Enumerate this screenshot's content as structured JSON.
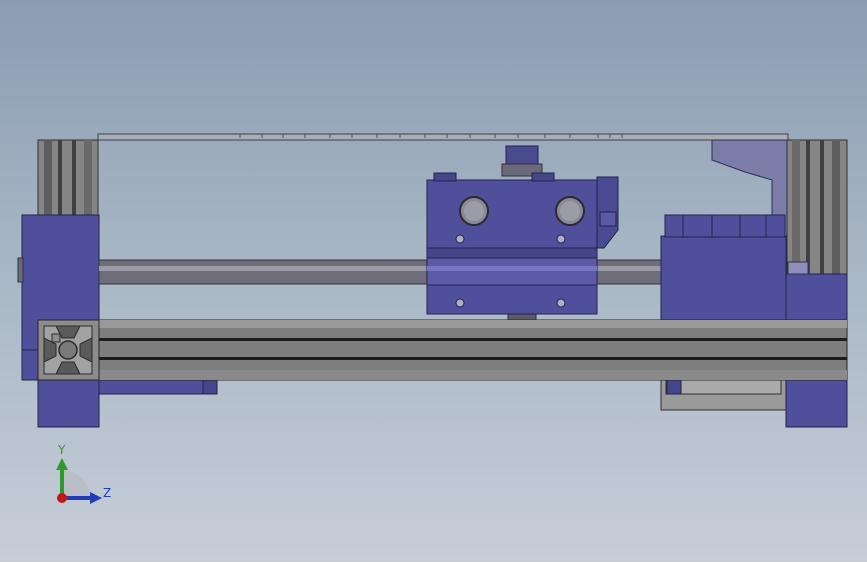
{
  "viewport": {
    "background_top": "#8a9db2",
    "background_bottom": "#c6ced8"
  },
  "model": {
    "part_color": "#4f4f9c",
    "extrusion_color": "#7a7a7a",
    "rod_color": "#6e6e7a",
    "components": [
      "aluminum-extrusion-rail",
      "left-end-bracket",
      "right-motor-mount",
      "carriage-block",
      "guide-rod",
      "lead-screw-nut",
      "top-frame-edge"
    ]
  },
  "triad": {
    "y_label": "Y",
    "z_label": "Z",
    "y_color": "#2e9a2e",
    "z_color": "#1f3db5",
    "x_color": "#c01818"
  }
}
